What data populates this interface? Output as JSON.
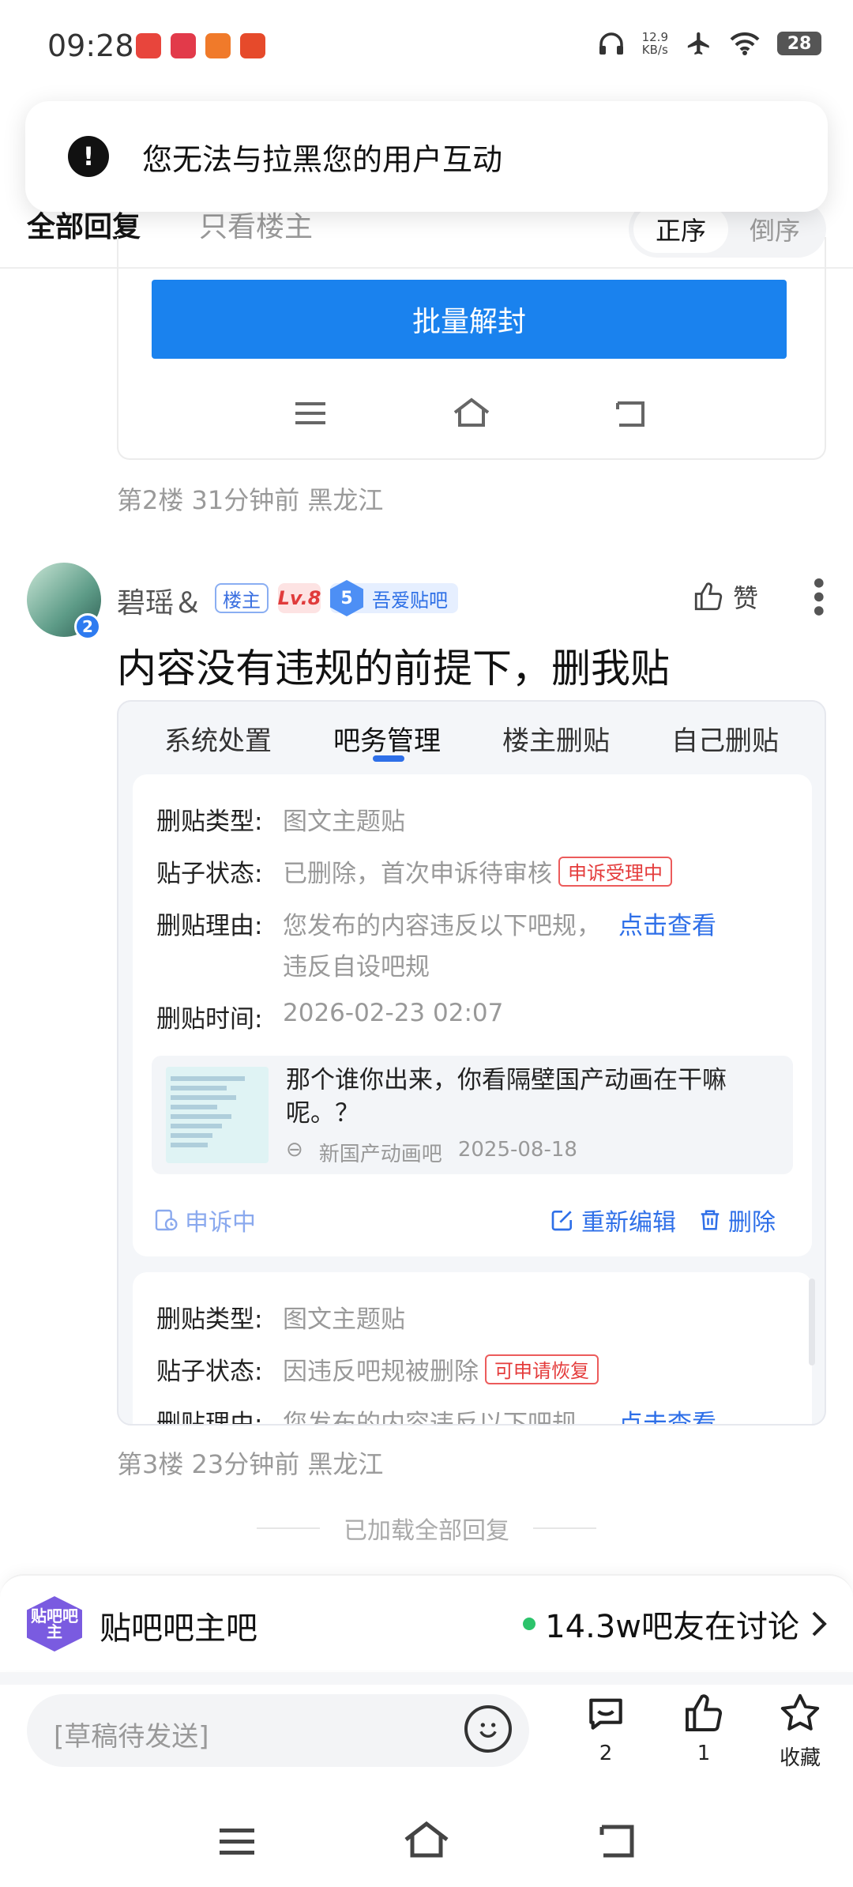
{
  "status_bar": {
    "time": "09:28",
    "net_speed_value": "12.9",
    "net_speed_unit": "KB/s",
    "battery": "28",
    "app_icons": [
      "app-icon-red-1",
      "app-icon-red-2",
      "app-icon-orange",
      "app-icon-red-3"
    ]
  },
  "toast": {
    "text": "您无法与拉黑您的用户互动"
  },
  "reply_tabs": {
    "all": "全部回复",
    "owner_only": "只看楼主",
    "sort_asc": "正序",
    "sort_desc": "倒序"
  },
  "floor2": {
    "batch_button": "批量解封",
    "meta": "第2楼 31分钟前 黑龙江"
  },
  "floor3": {
    "username": "碧瑶＆",
    "avatar_level": "2",
    "tag_owner": "楼主",
    "tag_level": "Lv.8",
    "fan_level": "5",
    "fan_label": "吾爱贴吧",
    "like_label": "赞",
    "title": "内容没有违规的前提下，删我贴",
    "card_tabs": [
      "系统处置",
      "吧务管理",
      "楼主删贴",
      "自己删贴"
    ],
    "record1": {
      "type_label": "删贴类型:",
      "type_value": "图文主题贴",
      "status_label": "贴子状态:",
      "status_value": "已删除，首次申诉待审核",
      "status_badge": "申诉受理中",
      "reason_label": "删贴理由:",
      "reason_value": "您发布的内容违反以下吧规，",
      "reason_link": "点击查看",
      "reason_line2": "违反自设吧规",
      "time_label": "删贴时间:",
      "time_value": "2026-02-23 02:07",
      "thread_title": "那个谁你出来，你看隔壁国产动画在干嘛呢。？",
      "thread_forum": "新国产动画吧",
      "thread_date": "2025-08-18",
      "appeal_label": "申诉中",
      "reedit_label": "重新编辑",
      "delete_label": "删除"
    },
    "record2": {
      "type_label": "删贴类型:",
      "type_value": "图文主题贴",
      "status_label": "贴子状态:",
      "status_value": "因违反吧规被删除",
      "status_badge": "可申请恢复",
      "reason_label": "删贴理由:",
      "reason_value": "您发布的内容违反以下吧规，",
      "reason_link": "点击查看"
    },
    "meta": "第3楼 23分钟前 黑龙江"
  },
  "loaded_all": "已加载全部回复",
  "forum_bar": {
    "logo_text": "贴吧吧主",
    "name": "贴吧吧主吧",
    "online": "14.3w吧友在讨论"
  },
  "bottom_bar": {
    "placeholder": "[草稿待发送]",
    "comment_count": "2",
    "like_count": "1",
    "favorite_label": "收藏"
  },
  "colors": {
    "accent": "#2e6fe8",
    "primary_button": "#1a82ee",
    "alert_red": "#e43b3b",
    "online_green": "#2cc36b"
  }
}
